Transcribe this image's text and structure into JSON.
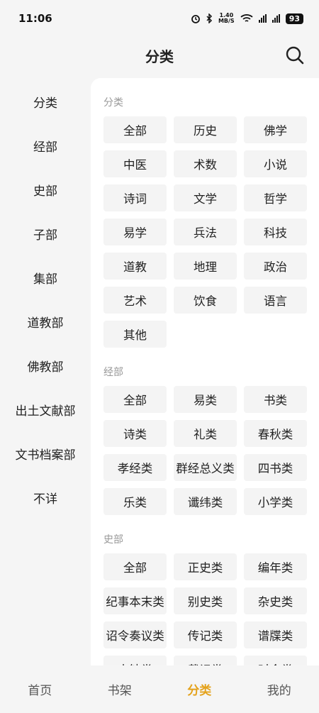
{
  "status_bar": {
    "time": "11:06",
    "net_speed": "1.40\nMB/S",
    "battery": "93",
    "icons": [
      "alarm-icon",
      "bluetooth-icon",
      "wifi-icon",
      "signal-5g-icon",
      "signal-5g-icon"
    ]
  },
  "header": {
    "title": "分类",
    "search_icon": "search-icon"
  },
  "sidebar": {
    "items": [
      "分类",
      "经部",
      "史部",
      "子部",
      "集部",
      "道教部",
      "佛教部",
      "出土文献部",
      "文书档案部",
      "不详"
    ]
  },
  "sections": [
    {
      "title": "分类",
      "tags": [
        "全部",
        "历史",
        "佛学",
        "中医",
        "术数",
        "小说",
        "诗词",
        "文学",
        "哲学",
        "易学",
        "兵法",
        "科技",
        "道教",
        "地理",
        "政治",
        "艺术",
        "饮食",
        "语言",
        "其他"
      ]
    },
    {
      "title": "经部",
      "tags": [
        "全部",
        "易类",
        "书类",
        "诗类",
        "礼类",
        "春秋类",
        "孝经类",
        "群经总义类",
        "四书类",
        "乐类",
        "谶纬类",
        "小学类"
      ]
    },
    {
      "title": "史部",
      "tags": [
        "全部",
        "正史类",
        "编年类",
        "纪事本末类",
        "别史类",
        "杂史类",
        "诏令奏议类",
        "传记类",
        "谱牒类",
        "史钞类",
        "载记类",
        "时令类"
      ]
    }
  ],
  "tabbar": {
    "tabs": [
      "首页",
      "书架",
      "分类",
      "我的"
    ],
    "active": "分类",
    "active_color": "#e4a21b"
  }
}
